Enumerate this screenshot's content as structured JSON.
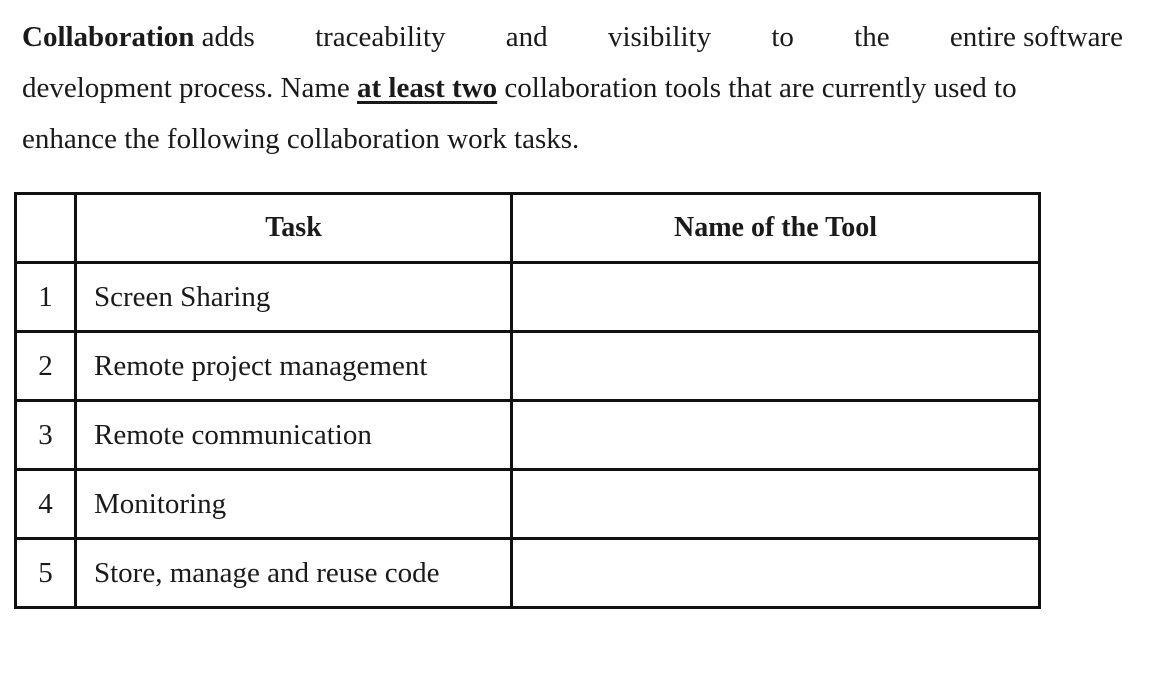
{
  "paragraph": {
    "line1": [
      "Collaboration",
      "adds",
      "traceability",
      "and",
      "visibility",
      "to",
      "the",
      "entire software"
    ],
    "line2_before": "development process. Name ",
    "line2_emph": "at least two",
    "line2_after": " collaboration tools that are currently used to",
    "line3": "enhance the following collaboration work tasks."
  },
  "table": {
    "headers": [
      "",
      "Task",
      "Name of the Tool"
    ],
    "rows": [
      {
        "num": "1",
        "task": "Screen Sharing",
        "tool": ""
      },
      {
        "num": "2",
        "task": "Remote project management",
        "tool": ""
      },
      {
        "num": "3",
        "task": "Remote communication",
        "tool": ""
      },
      {
        "num": "4",
        "task": "Monitoring",
        "tool": ""
      },
      {
        "num": "5",
        "task": "Store, manage and reuse code",
        "tool": ""
      }
    ]
  }
}
